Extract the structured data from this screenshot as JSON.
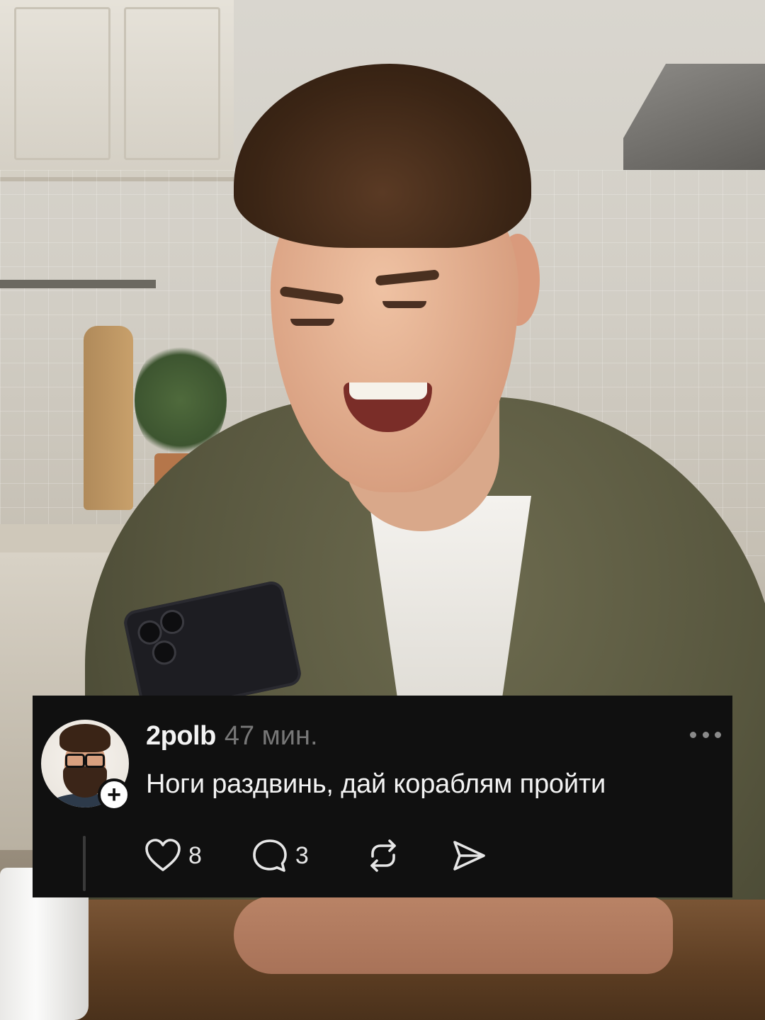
{
  "post": {
    "username": "2polb",
    "time": "47 мин.",
    "text": "Ноги раздвинь, дай кораблям пройти",
    "likes": "8",
    "comments": "3"
  },
  "icons": {
    "avatar": "avatar",
    "follow": "plus-icon",
    "more": "more-dots-icon",
    "like": "heart-icon",
    "comment": "comment-icon",
    "repost": "repost-icon",
    "share": "send-icon"
  },
  "colors": {
    "card_bg": "#101010",
    "text": "#f3f3f3",
    "muted": "#777777"
  }
}
